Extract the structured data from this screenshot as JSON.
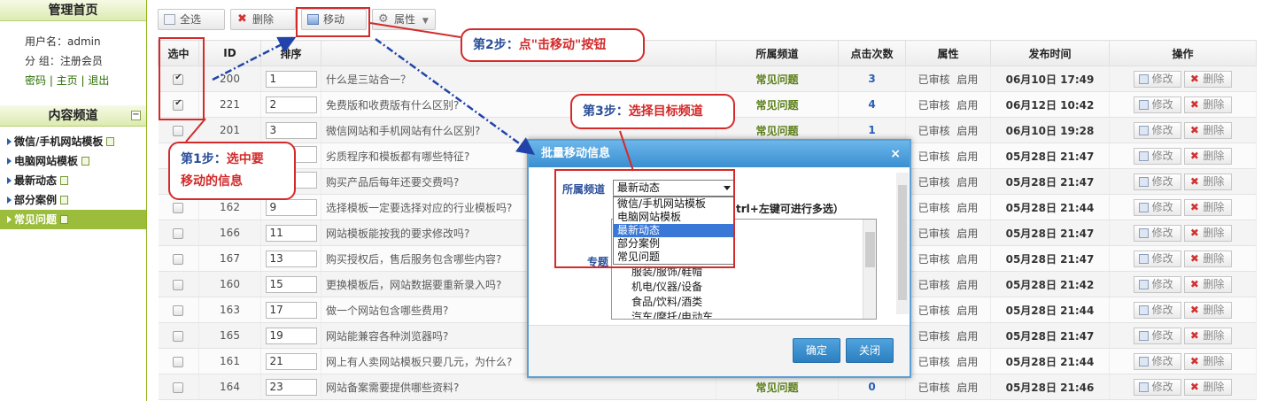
{
  "sidebar": {
    "title": "管理首页",
    "username_line": "用户名：admin",
    "group_line": "分 组：注册会员",
    "links": "密码 | 主页 | 退出",
    "channel_header": "内容频道",
    "collapse_glyph": "−",
    "channels": [
      {
        "label": "微信/手机网站模板",
        "active": false
      },
      {
        "label": "电脑网站模板",
        "active": false
      },
      {
        "label": "最新动态",
        "active": false
      },
      {
        "label": "部分案例",
        "active": false
      },
      {
        "label": "常见问题",
        "active": true
      }
    ]
  },
  "toolbar": {
    "select_all": "全选",
    "delete": "删除",
    "move": "移动",
    "props": "属性"
  },
  "table": {
    "headers": [
      "选中",
      "ID",
      "排序",
      "",
      "所属频道",
      "点击次数",
      "属性",
      "发布时间",
      "操作"
    ],
    "edit_label": "修改",
    "delete_label": "删除",
    "rows": [
      {
        "checked": true,
        "id": "200",
        "sort": "1",
        "title": "什么是三站合一？",
        "channel": "常见问题",
        "hits": "3",
        "status": "已审核",
        "enabled": "启用",
        "time": "06月10日 17:49"
      },
      {
        "checked": true,
        "id": "221",
        "sort": "2",
        "title": "免费版和收费版有什么区别?",
        "channel": "常见问题",
        "hits": "4",
        "status": "已审核",
        "enabled": "启用",
        "time": "06月12日 10:42"
      },
      {
        "checked": false,
        "id": "201",
        "sort": "3",
        "title": "微信网站和手机网站有什么区别?",
        "channel": "常见问题",
        "hits": "1",
        "status": "已审核",
        "enabled": "启用",
        "time": "06月10日 19:28"
      },
      {
        "checked": false,
        "id": "",
        "sort": "",
        "title": "劣质程序和模板都有哪些特征?",
        "channel": "",
        "hits": "",
        "status": "已审核",
        "enabled": "启用",
        "time": "05月28日 21:47"
      },
      {
        "checked": false,
        "id": "",
        "sort": "",
        "title": "购买产品后每年还要交费吗?",
        "channel": "",
        "hits": "",
        "status": "已审核",
        "enabled": "启用",
        "time": "05月28日 21:47"
      },
      {
        "checked": false,
        "id": "162",
        "sort": "9",
        "title": "选择模板一定要选择对应的行业模板吗?",
        "channel": "",
        "hits": "",
        "status": "已审核",
        "enabled": "启用",
        "time": "05月28日 21:44"
      },
      {
        "checked": false,
        "id": "166",
        "sort": "11",
        "title": "网站模板能按我的要求修改吗?",
        "channel": "",
        "hits": "",
        "status": "已审核",
        "enabled": "启用",
        "time": "05月28日 21:47"
      },
      {
        "checked": false,
        "id": "167",
        "sort": "13",
        "title": "购买授权后，售后服务包含哪些内容?",
        "channel": "",
        "hits": "",
        "status": "已审核",
        "enabled": "启用",
        "time": "05月28日 21:47"
      },
      {
        "checked": false,
        "id": "160",
        "sort": "15",
        "title": "更换模板后，网站数据要重新录入吗?",
        "channel": "",
        "hits": "",
        "status": "已审核",
        "enabled": "启用",
        "time": "05月28日 21:42"
      },
      {
        "checked": false,
        "id": "163",
        "sort": "17",
        "title": "做一个网站包含哪些费用?",
        "channel": "",
        "hits": "",
        "status": "已审核",
        "enabled": "启用",
        "time": "05月28日 21:44"
      },
      {
        "checked": false,
        "id": "165",
        "sort": "19",
        "title": "网站能兼容各种浏览器吗?",
        "channel": "",
        "hits": "",
        "status": "已审核",
        "enabled": "启用",
        "time": "05月28日 21:47"
      },
      {
        "checked": false,
        "id": "161",
        "sort": "21",
        "title": "网上有人卖网站模板只要几元，为什么?",
        "channel": "",
        "hits": "",
        "status": "已审核",
        "enabled": "启用",
        "time": "05月28日 21:44"
      },
      {
        "checked": false,
        "id": "164",
        "sort": "23",
        "title": "网站备案需要提供哪些资料?",
        "channel": "常见问题",
        "hits": "0",
        "status": "已审核",
        "enabled": "启用",
        "time": "05月28日 21:46"
      }
    ]
  },
  "callouts": {
    "step1_num": "第1步：",
    "step1_line1": "选中要",
    "step1_line2": "移动的信息",
    "step2_num": "第2步：",
    "step2_text": "点\"击移动\"按钮",
    "step3_num": "第3步：",
    "step3_text": "选择目标频道"
  },
  "dialog": {
    "title": "批量移动信息",
    "close_glyph": "×",
    "channel_label": "所属频道",
    "selected_channel": "最新动态",
    "options": [
      {
        "label": "微信/手机网站模板",
        "selected": false
      },
      {
        "label": "电脑网站模板",
        "selected": false
      },
      {
        "label": "最新动态",
        "selected": true
      },
      {
        "label": "部分案例",
        "selected": false
      },
      {
        "label": "常见问题",
        "selected": false
      }
    ],
    "multi_hint": "trl+左键可进行多选）",
    "topic_label": "专题",
    "topics": [
      "",
      "",
      "",
      "服装/服饰/鞋帽",
      "机电/仪器/设备",
      "食品/饮料/酒类",
      "汽车/摩托/电动车"
    ],
    "ok": "确定",
    "close": "关闭"
  },
  "colors": {
    "accent_green": "#9bbd3b",
    "annotation_red": "#d42a2a",
    "dialog_blue": "#3a8fd1",
    "arrow_blue": "#2244aa"
  }
}
